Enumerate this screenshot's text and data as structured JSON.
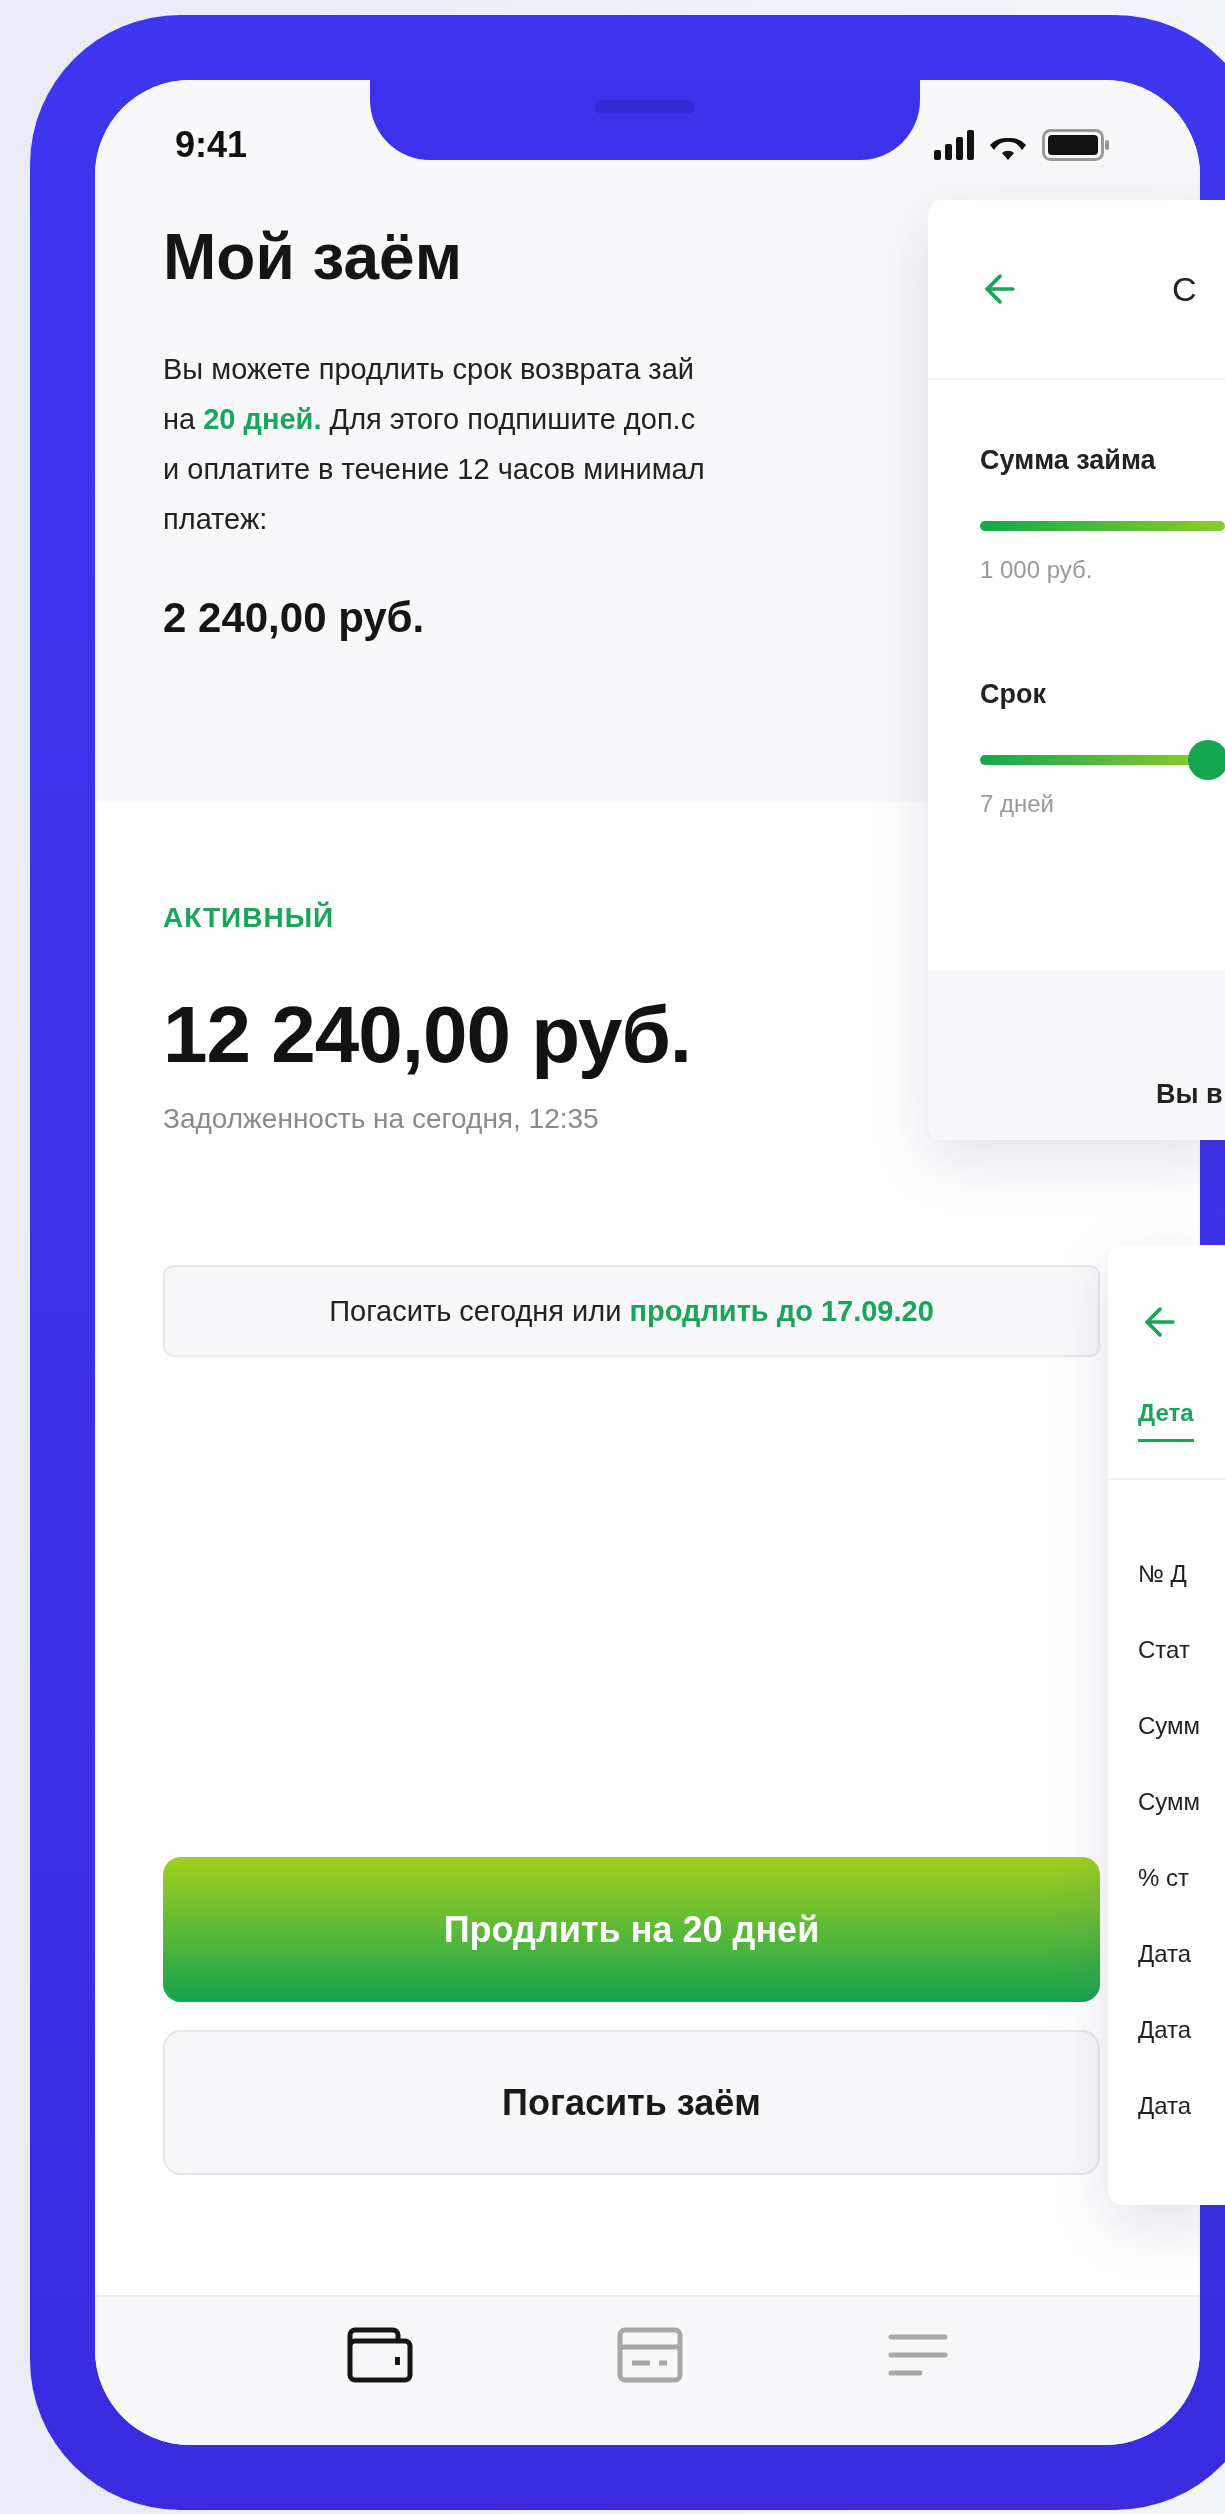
{
  "status_bar": {
    "time": "9:41"
  },
  "header": {
    "title": "Мой заём",
    "lines": [
      "Вы можете продлить срок возврата зай",
      "на **20 дней.** Для этого подпишите доп.с",
      "и оплатите в течение 12 часов минимал",
      "платеж:"
    ],
    "payment": "2 240,00 руб."
  },
  "loan": {
    "status": "АКТИВНЫЙ",
    "amount": "12 240,00 руб.",
    "caption": "Задолженность на сегодня, 12:35",
    "notice_prefix": "Погасить сегодня или",
    "notice_link": "продлить до 17.09.20"
  },
  "actions": [
    {
      "kind": "primary",
      "label": "Продлить на 20 дней"
    },
    {
      "kind": "secondary",
      "label": "Погасить заём"
    }
  ],
  "tab_bar": {
    "items": [
      {
        "kind": "wallet",
        "selected": true
      },
      {
        "kind": "card",
        "selected": false
      },
      {
        "kind": "menu",
        "selected": false
      }
    ]
  },
  "quote_card": {
    "title": "С",
    "sliders": [
      {
        "label": "Сумма займа",
        "level": 1,
        "min_label": "1 000 руб."
      },
      {
        "label": "Срок",
        "level": 0.93,
        "min_label": "7 дней"
      }
    ],
    "footer": "Вы в"
  },
  "details_card": {
    "tab": "Дета",
    "rows": [
      "№ Д",
      "Стат",
      "Сумм",
      "Сумм",
      "% ст",
      "Дата",
      "Дата",
      "Дата"
    ]
  }
}
